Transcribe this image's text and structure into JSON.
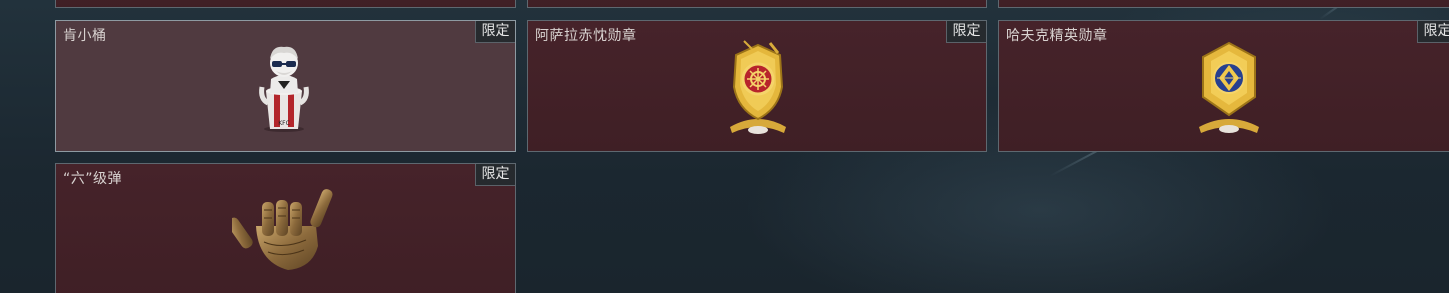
{
  "items": [
    {
      "name": "肯小桶",
      "badge": "限定",
      "icon": "kfc-bucket-figure-icon"
    },
    {
      "name": "阿萨拉赤忱勋章",
      "badge": "限定",
      "icon": "gold-red-medal-icon"
    },
    {
      "name": "哈夫克精英勋章",
      "badge": "限定",
      "icon": "gold-blue-medal-icon"
    },
    {
      "name": "“六”级弹",
      "badge": "限定",
      "icon": "bullet-hand-gesture-icon"
    }
  ],
  "colors": {
    "card_bg": "#42212a",
    "card_selected_bg": "#503a40",
    "background": "#1c2a33",
    "badge_bg": "#262a2e"
  }
}
